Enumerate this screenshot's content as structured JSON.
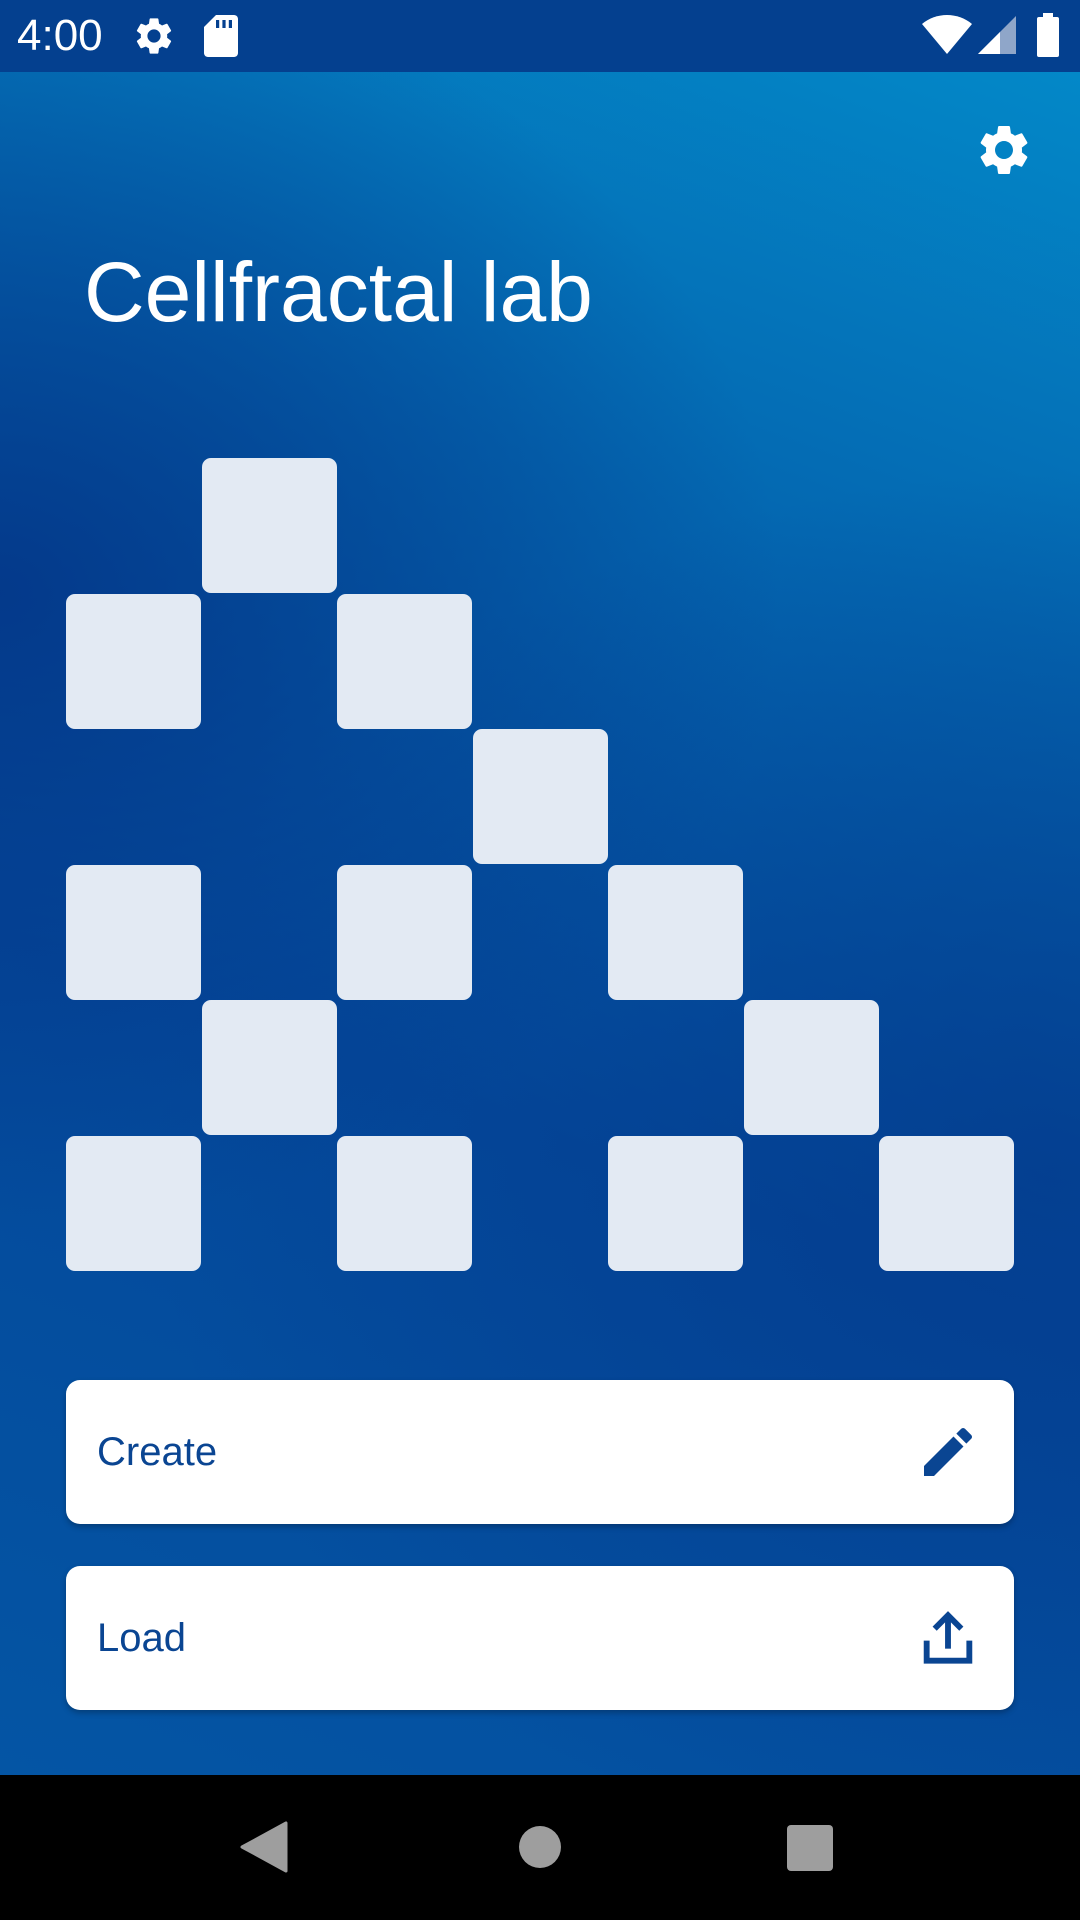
{
  "status_bar": {
    "time": "4:00",
    "icons": [
      "settings-icon",
      "sd-card-icon",
      "wifi-icon",
      "signal-icon",
      "battery-icon"
    ]
  },
  "app": {
    "title": "Cellfractal lab",
    "settings_icon": "gear-icon"
  },
  "fractal": {
    "cell_color": "#e3eaf3",
    "rows": [
      [
        0,
        1,
        0,
        0,
        0,
        0,
        0
      ],
      [
        1,
        0,
        1,
        0,
        0,
        0,
        0
      ],
      [
        0,
        0,
        0,
        1,
        0,
        0,
        0
      ],
      [
        1,
        0,
        1,
        0,
        1,
        0,
        0
      ],
      [
        0,
        1,
        0,
        0,
        0,
        1,
        0
      ],
      [
        1,
        0,
        1,
        0,
        1,
        0,
        1
      ]
    ]
  },
  "actions": {
    "create": {
      "label": "Create",
      "icon": "pencil-icon"
    },
    "load": {
      "label": "Load",
      "icon": "upload-icon"
    }
  },
  "nav_bar": {
    "buttons": [
      "back-icon",
      "home-icon",
      "recents-icon"
    ]
  },
  "colors": {
    "status_bar": "#04408f",
    "accent_text": "#0a4592",
    "button_bg": "#ffffff"
  }
}
